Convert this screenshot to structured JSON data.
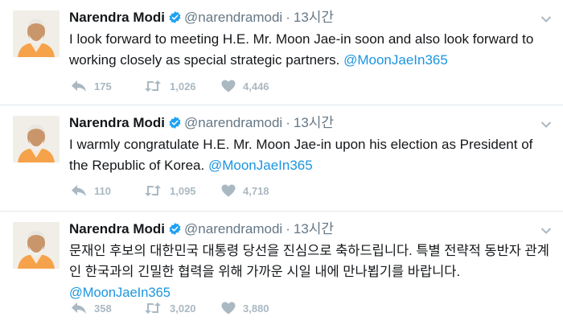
{
  "tweets": [
    {
      "name": "Narendra Modi",
      "handle": "@narendramodi",
      "time": "13시간",
      "text": "I look forward to meeting H.E. Mr. Moon Jae-in soon and also look forward to working closely as special strategic partners.",
      "mention": "@MoonJaeIn365",
      "replies": "175",
      "retweets": "1,026",
      "likes": "4,446"
    },
    {
      "name": "Narendra Modi",
      "handle": "@narendramodi",
      "time": "13시간",
      "text": "I warmly congratulate H.E. Mr. Moon Jae-in upon his election as President of the Republic of Korea.",
      "mention": "@MoonJaeIn365",
      "replies": "110",
      "retweets": "1,095",
      "likes": "4,718"
    },
    {
      "name": "Narendra Modi",
      "handle": "@narendramodi",
      "time": "13시간",
      "text": "문재인 후보의 대한민국 대통령 당선을 진심으로 축하드립니다. 특별 전략적 동반자 관계인 한국과의 긴밀한 협력을 위해 가까운 시일 내에 만나뵙기를 바랍니다.",
      "mention": "@MoonJaeIn365",
      "replies": "358",
      "retweets": "3,020",
      "likes": "3,880"
    }
  ],
  "icons": {
    "verified": "verified-badge-icon",
    "caret": "chevron-down-icon",
    "reply": "reply-icon",
    "retweet": "retweet-icon",
    "like": "heart-icon"
  },
  "colors": {
    "link": "#1b95e0",
    "verified": "#1da1f2",
    "muted": "#657786",
    "action": "#aab8c2",
    "divider": "#e1e8ed"
  }
}
